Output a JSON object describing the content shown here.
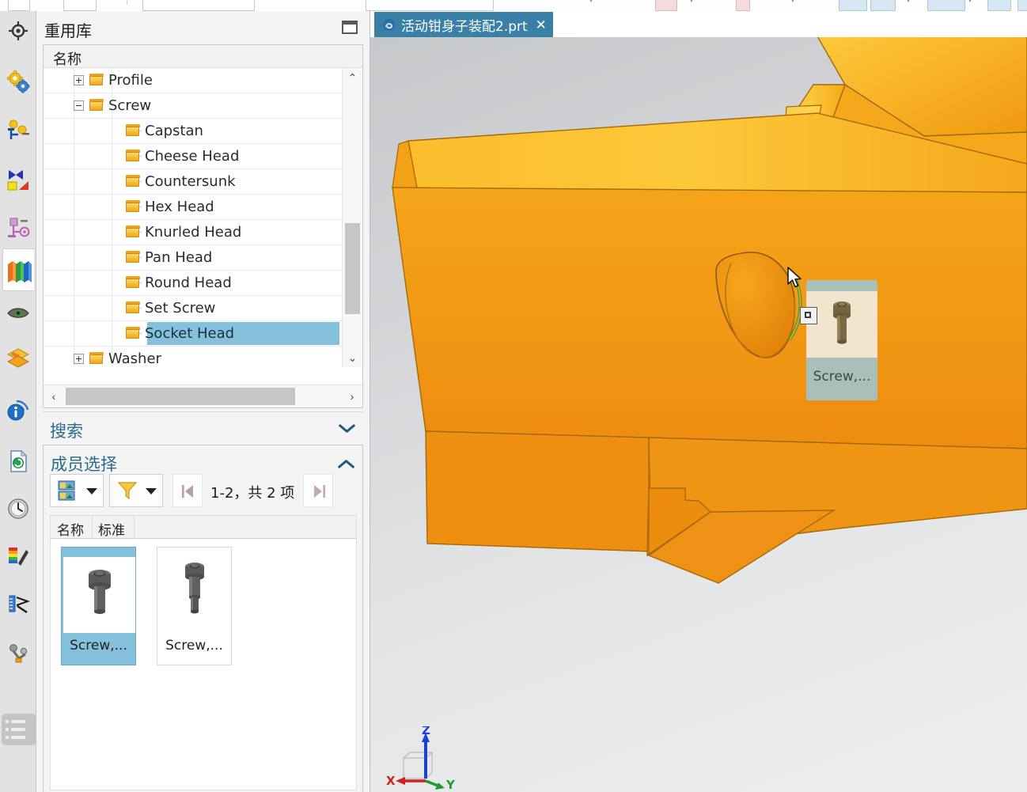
{
  "app": {
    "accent_blue": "#3a7fa5",
    "select_blue": "#86c1dc",
    "model_orange": "#ee8c10",
    "panel_bg": "#f4f4f4"
  },
  "rail": {
    "items": [
      {
        "name": "target-icon",
        "label": "",
        "active": false
      },
      {
        "name": "gears-icon",
        "label": "",
        "active": false
      },
      {
        "name": "assembly-constraint-icon",
        "label": "",
        "active": false
      },
      {
        "name": "mirror-assembly-icon",
        "label": "",
        "active": false
      },
      {
        "name": "component-group-icon",
        "label": "",
        "active": false
      },
      {
        "name": "reuse-library-icon",
        "label": "",
        "active": true
      },
      {
        "name": "eye-visibility-icon",
        "label": "",
        "active": false
      },
      {
        "name": "layers-icon",
        "label": "",
        "active": false
      },
      {
        "name": "information-icon",
        "label": "",
        "active": false
      },
      {
        "name": "document-refresh-icon",
        "label": "",
        "active": false
      },
      {
        "name": "history-clock-icon",
        "label": "",
        "active": false
      },
      {
        "name": "palette-icon",
        "label": "",
        "active": false
      },
      {
        "name": "measure-icon",
        "label": "",
        "active": false
      },
      {
        "name": "mechanism-icon",
        "label": "",
        "active": false
      }
    ],
    "bottom_item": {
      "name": "list-menu-icon",
      "label": ""
    }
  },
  "dock": {
    "title": "重用库",
    "maximize_label": "",
    "tree": {
      "column_header": "名称",
      "nodes": [
        {
          "label": "Profile",
          "depth": 1,
          "expander": "plus",
          "selected": false
        },
        {
          "label": "Screw",
          "depth": 1,
          "expander": "minus",
          "selected": false
        },
        {
          "label": "Capstan",
          "depth": 2,
          "expander": "none",
          "selected": false
        },
        {
          "label": "Cheese Head",
          "depth": 2,
          "expander": "none",
          "selected": false
        },
        {
          "label": "Countersunk",
          "depth": 2,
          "expander": "none",
          "selected": false
        },
        {
          "label": "Hex Head",
          "depth": 2,
          "expander": "none",
          "selected": false
        },
        {
          "label": "Knurled Head",
          "depth": 2,
          "expander": "none",
          "selected": false
        },
        {
          "label": "Pan Head",
          "depth": 2,
          "expander": "none",
          "selected": false
        },
        {
          "label": "Round Head",
          "depth": 2,
          "expander": "none",
          "selected": false
        },
        {
          "label": "Set Screw",
          "depth": 2,
          "expander": "none",
          "selected": false
        },
        {
          "label": "Socket Head",
          "depth": 2,
          "expander": "none",
          "selected": true
        },
        {
          "label": "Washer",
          "depth": 1,
          "expander": "plus",
          "selected": false
        }
      ],
      "scroll_up": "⌃",
      "scroll_down": "⌄",
      "scroll_left": "‹",
      "scroll_right": "›"
    },
    "search_section": {
      "title": "搜索",
      "state": "collapsed"
    },
    "member_section": {
      "title": "成员选择",
      "state": "expanded",
      "toolbar": {
        "view_mode_button": "thumbnail-view",
        "filter_button": "filter",
        "first_page_button": "|◀",
        "last_page_button": "▶|",
        "page_info": "1-2，共 2 项"
      },
      "columns": [
        "名称",
        "标准"
      ],
      "items": [
        {
          "name": "Screw,...",
          "selected": true
        },
        {
          "name": "Screw,...",
          "selected": false
        }
      ]
    }
  },
  "viewport": {
    "tab": {
      "title": "活动钳身子装配2.prt",
      "close": "✕",
      "icon": "part-file-icon"
    },
    "drag_preview": {
      "name": "Screw,...",
      "badge": "drop-target-badge"
    },
    "triad": {
      "x_label": "X",
      "y_label": "Y",
      "z_label": "Z"
    }
  }
}
